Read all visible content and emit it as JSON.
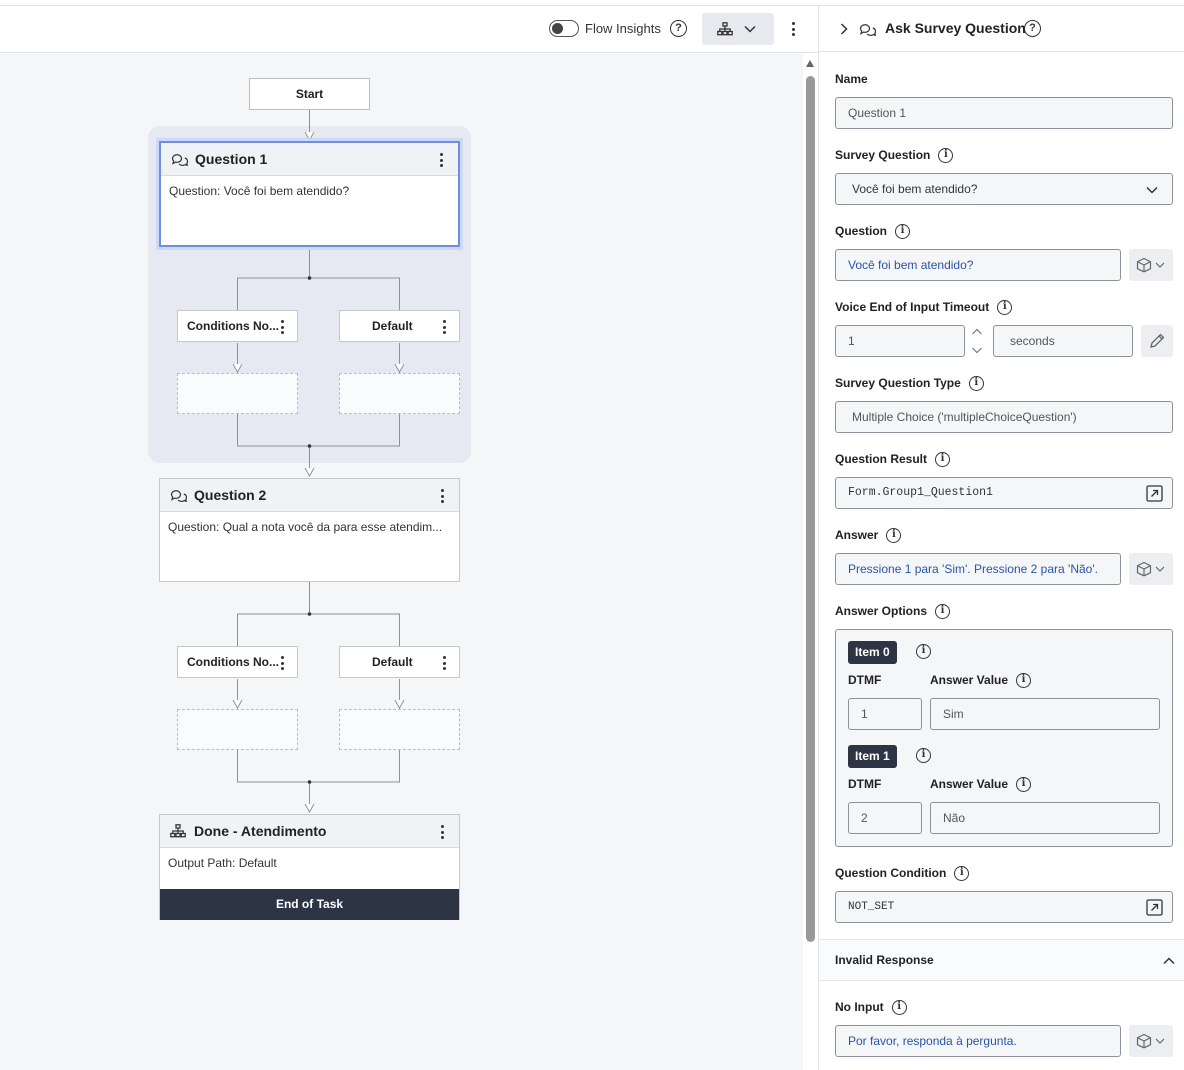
{
  "toolbar": {
    "flow_insights_label": "Flow Insights",
    "help_label": "?"
  },
  "flow": {
    "start_label": "Start",
    "question1": {
      "title": "Question 1",
      "body": "Question: Você foi bem atendido?"
    },
    "question1_branches": {
      "left": "Conditions No...",
      "right": "Default"
    },
    "question2": {
      "title": "Question 2",
      "body": "Question: Qual a nota você da para esse atendim..."
    },
    "question2_branches": {
      "left": "Conditions No...",
      "right": "Default"
    },
    "done": {
      "title": "Done - Atendimento",
      "body": "Output Path: Default",
      "footer": "End of Task"
    }
  },
  "panel": {
    "title": "Ask Survey Question",
    "help": "?",
    "name_label": "Name",
    "name_value": "Question 1",
    "survey_question_label": "Survey Question",
    "survey_question_value": "Você foi bem atendido?",
    "question_label": "Question",
    "question_value": "Você foi bem atendido?",
    "timeout_label": "Voice End of Input Timeout",
    "timeout_value": "1",
    "timeout_unit": "seconds",
    "type_label": "Survey Question Type",
    "type_value": "Multiple Choice ('multipleChoiceQuestion')",
    "result_label": "Question Result",
    "result_value": "Form.Group1_Question1",
    "answer_label": "Answer",
    "answer_value": "Pressione 1 para 'Sim'. Pressione 2 para 'Não'.",
    "options_label": "Answer Options",
    "options": [
      {
        "badge": "Item 0",
        "dtmf_label": "DTMF",
        "value_label": "Answer Value",
        "dtmf": "1",
        "value": "Sim"
      },
      {
        "badge": "Item 1",
        "dtmf_label": "DTMF",
        "value_label": "Answer Value",
        "dtmf": "2",
        "value": "Não"
      }
    ],
    "condition_label": "Question Condition",
    "condition_value": "NOT_SET",
    "invalid_response_label": "Invalid Response",
    "no_input_label": "No Input",
    "no_input_value": "Por favor, responda à pergunta.",
    "info_glyph": "i"
  }
}
